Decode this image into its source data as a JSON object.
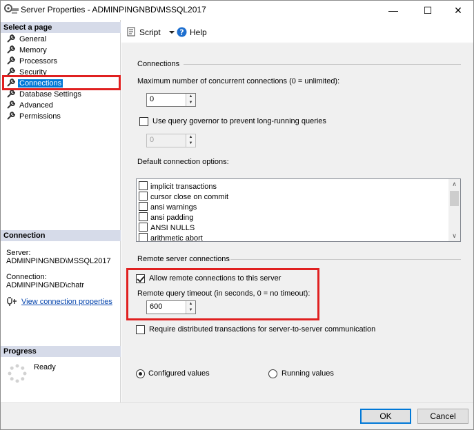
{
  "window": {
    "title": "Server Properties - ADMINPINGNBD\\MSSQL2017",
    "minimize_glyph": "—",
    "maximize_glyph": "☐",
    "close_glyph": "✕"
  },
  "left_pane": {
    "select_page_header": "Select a page",
    "pages": [
      {
        "label": "General",
        "icon": "wrench-icon"
      },
      {
        "label": "Memory",
        "icon": "wrench-icon"
      },
      {
        "label": "Processors",
        "icon": "wrench-icon"
      },
      {
        "label": "Security",
        "icon": "wrench-icon"
      },
      {
        "label": "Connections",
        "icon": "wrench-icon",
        "selected": true
      },
      {
        "label": "Database Settings",
        "icon": "wrench-icon"
      },
      {
        "label": "Advanced",
        "icon": "wrench-icon"
      },
      {
        "label": "Permissions",
        "icon": "wrench-icon"
      }
    ],
    "connection_header": "Connection",
    "server_label": "Server:",
    "server_value": "ADMINPINGNBD\\MSSQL2017",
    "connection_label": "Connection:",
    "connection_value": "ADMINPINGNBD\\chatr",
    "view_link": "View connection properties",
    "progress_header": "Progress",
    "progress_status": "Ready"
  },
  "toolbar": {
    "script_label": "Script",
    "help_label": "Help"
  },
  "connections": {
    "group_title": "Connections",
    "max_label": "Maximum number of concurrent connections (0 = unlimited):",
    "max_value": "0",
    "governor_label": "Use query governor to prevent long-running queries",
    "governor_checked": false,
    "governor_value": "0",
    "defaults_label": "Default connection options:",
    "options": [
      {
        "label": "implicit transactions",
        "checked": false
      },
      {
        "label": "cursor close on commit",
        "checked": false
      },
      {
        "label": "ansi warnings",
        "checked": false
      },
      {
        "label": "ansi padding",
        "checked": false
      },
      {
        "label": "ANSI NULLS",
        "checked": false
      },
      {
        "label": "arithmetic abort",
        "checked": false
      }
    ]
  },
  "remote": {
    "group_title": "Remote server connections",
    "allow_label": "Allow remote connections to this server",
    "allow_checked": true,
    "timeout_label": "Remote query timeout (in seconds, 0 = no timeout):",
    "timeout_value": "600",
    "distributed_label": "Require distributed transactions for server-to-server communication",
    "distributed_checked": false
  },
  "view_mode": {
    "configured_label": "Configured values",
    "running_label": "Running values",
    "selected": "configured"
  },
  "buttons": {
    "ok_label": "OK",
    "cancel_label": "Cancel"
  },
  "colors": {
    "selection": "#0078d7",
    "highlight_box": "#e02020",
    "header_band": "#d6dbe9",
    "link": "#0645ad"
  }
}
